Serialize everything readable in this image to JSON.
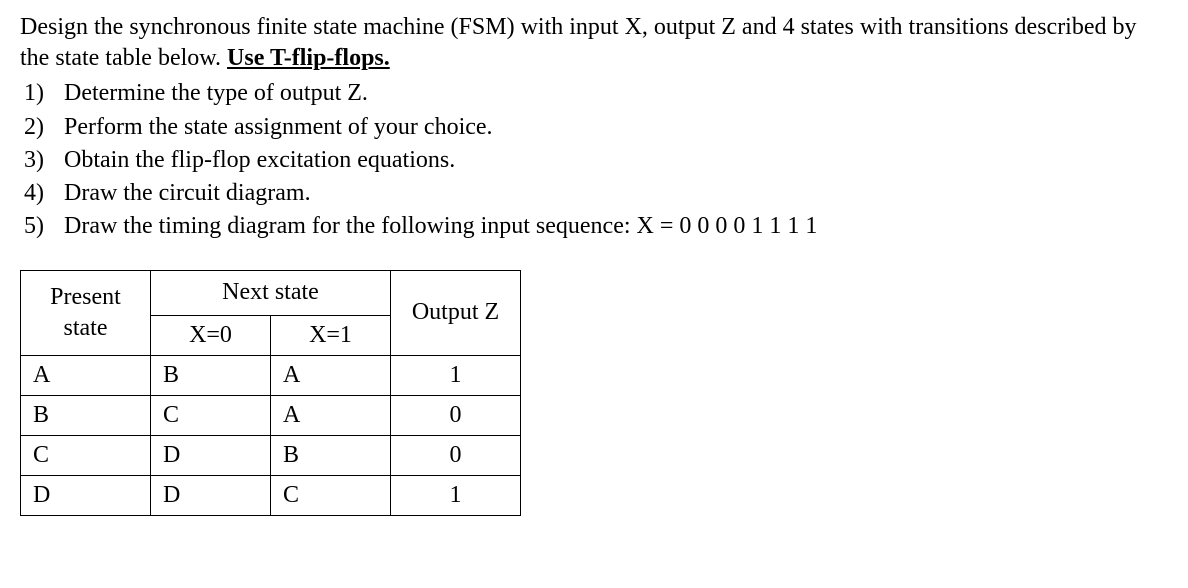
{
  "intro": {
    "part1": "Design the synchronous finite state machine (FSM) with input X,  output Z and  4 states with  transitions described by the state table below. ",
    "emphasis": "Use T-flip-flops."
  },
  "tasks": [
    {
      "num": "1)",
      "text": "Determine the type of output Z."
    },
    {
      "num": "2)",
      "text": "Perform the state assignment of your choice."
    },
    {
      "num": "3)",
      "text": "Obtain the flip-flop excitation equations."
    },
    {
      "num": "4)",
      "text": "Draw the circuit diagram."
    },
    {
      "num": "5)",
      "text": "Draw the timing diagram for the following input sequence: X =  0 0 0 0 1 1 1 1"
    }
  ],
  "table": {
    "headers": {
      "present": "Present state",
      "next": "Next state",
      "output": "Output Z",
      "x0": "X=0",
      "x1": "X=1"
    },
    "rows": [
      {
        "ps": "A",
        "x0": "B",
        "x1": "A",
        "z": "1"
      },
      {
        "ps": "B",
        "x0": "C",
        "x1": "A",
        "z": "0"
      },
      {
        "ps": "C",
        "x0": "D",
        "x1": "B",
        "z": "0"
      },
      {
        "ps": "D",
        "x0": "D",
        "x1": "C",
        "z": "1"
      }
    ]
  }
}
